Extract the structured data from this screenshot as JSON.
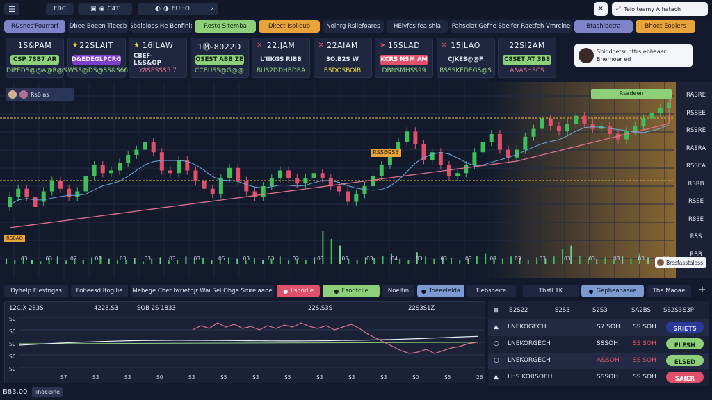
{
  "colors": {
    "bg": "#141a2e",
    "panel": "#1e2640",
    "up": "#3fbf5a",
    "down": "#e0506a",
    "gold": "#c9a43a",
    "pink": "#e07090",
    "accent_orange": "#e8a43a",
    "accent_green": "#8ed07a",
    "accent_purple": "#7d84c8"
  },
  "topbar": {
    "menu_icon": "menu-icon",
    "tool_a": "EBC",
    "tool_b_icons": [
      "grid-icon",
      "circle-icon"
    ],
    "tool_b_label": "C4T",
    "tool_c_icons": [
      "settings-icon",
      "layers-icon"
    ],
    "tool_c_label": "6UHO",
    "add_icon": "chevron-icon",
    "close_icon": "close-icon",
    "search_text": "Teio teamy A hatach"
  },
  "tabs": [
    {
      "label": "R&snes'Fourrarf",
      "style": "purple"
    },
    {
      "label": "Dbee Boeen Tieecb",
      "style": "dark"
    },
    {
      "label": "Gbolelods He Benfinie",
      "style": "dark"
    },
    {
      "label": "Rosto Sitemba",
      "style": "green"
    },
    {
      "label": "Dkect Isolleub",
      "style": "orange"
    },
    {
      "label": "Nolhrg Rsliefoares",
      "style": "dark"
    },
    {
      "label": "HElvfes fea shla",
      "style": "dark"
    },
    {
      "label": "Pahselat Gefhe Sbeifer Raetfeh Vmrcine",
      "style": "dark"
    },
    {
      "label": "Btashibetra",
      "style": "purple"
    },
    {
      "label": "Bhoet Eoplers",
      "style": "orange"
    }
  ],
  "cards": [
    {
      "t1": "1S&PAM",
      "pill": "CSP 7SB7 AR",
      "pillcolor": "green",
      "t3": "DIPEDS@@A@R@S",
      "t3color": "green",
      "icon": ""
    },
    {
      "t1": "22SLAIT",
      "pill": "D&EDEGLPCRG",
      "pillcolor": "purple",
      "t3": "WSS@DS@SS&S66",
      "t3color": "green",
      "icon": "star-icon"
    },
    {
      "t1": "16ILAW",
      "pill": "CBEF- L&S&OP",
      "pillcolor": "none",
      "t3": "Y8SESSS5.7",
      "t3color": "pink",
      "icon": "star-icon"
    },
    {
      "t1": "1Ⓜ-8022D",
      "pill": "OSEST ABB ZE",
      "pillcolor": "green",
      "t3": "CCBUSS@G@@",
      "t3color": "green",
      "icon": ""
    },
    {
      "t1": "22.JAM",
      "pill": "L'IIKGS RIBB",
      "pillcolor": "none",
      "t3": "BUS2DDHBDBA",
      "t3color": "green",
      "icon": "x-icon"
    },
    {
      "t1": "22AIAM",
      "pill": "3O.B2S W",
      "pillcolor": "none",
      "t3": "BSDOSBOIB",
      "t3color": "yellow",
      "icon": "x-icon"
    },
    {
      "t1": "15SLAD",
      "pill": "KCRS NSM AM",
      "pillcolor": "red",
      "t3": "DBNSMHSS99",
      "t3color": "green",
      "icon": "arrow-icon"
    },
    {
      "t1": "15JLAO",
      "pill": "CJKES@@F",
      "pillcolor": "none",
      "t3": "BSSSKEDEGS@S",
      "t3color": "green",
      "icon": "x-icon"
    },
    {
      "t1": "22SI2AM",
      "pill": "C8SET AT 3B8",
      "pillcolor": "green",
      "t3": "A&ASHSCS",
      "t3color": "pink",
      "icon": ""
    }
  ],
  "notification": {
    "title": "Sbiddoetsr bttrs ebhaaer",
    "body": "Bnernoer ed"
  },
  "chart": {
    "header_chip": "Rs6 as",
    "label_right_top": "Rsadeen",
    "box_label": "RSSEGSB",
    "left_tag": "RS8AO",
    "axis_labels": [
      "RASRE",
      "RSSEE",
      "RSSRE",
      "RASRA",
      "RSSEA",
      "RSRB",
      "RSSE",
      "R83E",
      "RSS",
      "RBB"
    ],
    "x_labels": [
      "03",
      "03",
      "02",
      "03",
      "03",
      "03",
      "03",
      "03",
      "05",
      "03",
      "03",
      "03",
      "03",
      "03",
      "03",
      "04",
      "03",
      "03",
      "03",
      "03",
      "03",
      "03",
      "03",
      "03",
      "03",
      "03",
      "03"
    ],
    "badge_br": "Brssfasstalass",
    "candles": [
      {
        "o": 320,
        "c": 300
      },
      {
        "o": 300,
        "c": 285
      },
      {
        "o": 285,
        "c": 300
      },
      {
        "o": 300,
        "c": 320
      },
      {
        "o": 310,
        "c": 290
      },
      {
        "o": 290,
        "c": 270
      },
      {
        "o": 270,
        "c": 285
      },
      {
        "o": 285,
        "c": 300
      },
      {
        "o": 300,
        "c": 290
      },
      {
        "o": 290,
        "c": 260
      },
      {
        "o": 260,
        "c": 240
      },
      {
        "o": 240,
        "c": 255
      },
      {
        "o": 255,
        "c": 250
      },
      {
        "o": 250,
        "c": 235
      },
      {
        "o": 235,
        "c": 220
      },
      {
        "o": 220,
        "c": 210
      },
      {
        "o": 210,
        "c": 195
      },
      {
        "o": 195,
        "c": 215
      },
      {
        "o": 215,
        "c": 250
      },
      {
        "o": 250,
        "c": 255
      },
      {
        "o": 255,
        "c": 230
      },
      {
        "o": 230,
        "c": 250
      },
      {
        "o": 250,
        "c": 270
      },
      {
        "o": 270,
        "c": 285
      },
      {
        "o": 285,
        "c": 295
      },
      {
        "o": 295,
        "c": 265
      },
      {
        "o": 265,
        "c": 245
      },
      {
        "o": 245,
        "c": 270
      },
      {
        "o": 270,
        "c": 290
      },
      {
        "o": 290,
        "c": 300
      },
      {
        "o": 300,
        "c": 280
      },
      {
        "o": 280,
        "c": 265
      },
      {
        "o": 265,
        "c": 250
      },
      {
        "o": 250,
        "c": 265
      },
      {
        "o": 265,
        "c": 275
      },
      {
        "o": 275,
        "c": 265
      },
      {
        "o": 265,
        "c": 255
      },
      {
        "o": 255,
        "c": 265
      },
      {
        "o": 265,
        "c": 280
      },
      {
        "o": 280,
        "c": 290
      },
      {
        "o": 290,
        "c": 310
      },
      {
        "o": 310,
        "c": 295
      },
      {
        "o": 295,
        "c": 280
      },
      {
        "o": 280,
        "c": 260
      },
      {
        "o": 260,
        "c": 240
      },
      {
        "o": 240,
        "c": 215
      },
      {
        "o": 215,
        "c": 195
      },
      {
        "o": 195,
        "c": 175
      },
      {
        "o": 175,
        "c": 200
      },
      {
        "o": 200,
        "c": 230
      },
      {
        "o": 230,
        "c": 215
      },
      {
        "o": 215,
        "c": 240
      },
      {
        "o": 240,
        "c": 260
      },
      {
        "o": 260,
        "c": 255
      },
      {
        "o": 255,
        "c": 240
      },
      {
        "o": 240,
        "c": 215
      },
      {
        "o": 215,
        "c": 195
      },
      {
        "o": 195,
        "c": 180
      },
      {
        "o": 180,
        "c": 210
      },
      {
        "o": 210,
        "c": 225
      },
      {
        "o": 225,
        "c": 210
      },
      {
        "o": 210,
        "c": 185
      },
      {
        "o": 185,
        "c": 170
      },
      {
        "o": 170,
        "c": 150
      },
      {
        "o": 150,
        "c": 165
      },
      {
        "o": 165,
        "c": 175
      },
      {
        "o": 175,
        "c": 160
      },
      {
        "o": 160,
        "c": 145
      },
      {
        "o": 145,
        "c": 160
      },
      {
        "o": 160,
        "c": 170
      },
      {
        "o": 170,
        "c": 165
      },
      {
        "o": 165,
        "c": 180
      },
      {
        "o": 180,
        "c": 190
      },
      {
        "o": 190,
        "c": 175
      },
      {
        "o": 175,
        "c": 165
      },
      {
        "o": 165,
        "c": 150
      },
      {
        "o": 150,
        "c": 140
      },
      {
        "o": 140,
        "c": 130
      },
      {
        "o": 130,
        "c": 120
      }
    ],
    "volume": [
      6,
      4,
      8,
      5,
      3,
      7,
      9,
      4,
      6,
      5,
      8,
      10,
      6,
      4,
      5,
      7,
      3,
      6,
      8,
      4,
      5,
      9,
      6,
      7,
      4,
      5,
      8,
      6,
      4,
      7,
      5,
      6,
      9,
      4,
      6,
      5,
      8,
      40,
      30,
      22,
      6,
      5,
      8,
      7,
      10,
      12,
      6,
      5,
      14,
      9,
      6,
      8,
      7,
      5,
      6,
      10,
      12,
      8,
      6,
      9,
      7,
      5,
      8,
      6,
      9,
      18,
      22,
      10,
      7,
      6,
      8,
      5,
      9,
      7,
      12,
      8,
      6,
      5
    ]
  },
  "bottom_tabs": [
    {
      "label": "Dyhelp Elestnges",
      "style": "plain"
    },
    {
      "label": "Fobeesd Itogilie",
      "style": "plain"
    },
    {
      "label": "Mebege Chet Iwrietnjr Wai Sel Ohge Snirelaane",
      "style": "plain"
    },
    {
      "label": "Ilshodie",
      "style": "red"
    },
    {
      "label": "Esodtclie",
      "style": "green"
    },
    {
      "label": "Noeltin",
      "style": "plain"
    },
    {
      "label": "Toeeelelda",
      "style": "blue"
    },
    {
      "label": "Tlebsheite",
      "style": "plain"
    },
    {
      "label": "Tbstl 1K",
      "style": "plain"
    },
    {
      "label": "Gepheanasiie",
      "style": "blue"
    },
    {
      "label": "The Maoae",
      "style": "plain"
    }
  ],
  "lower_chart": {
    "headers": [
      "12C.X 2S3S",
      "4228.S3",
      "SOB 2S 1833",
      "22S.S3S",
      "22S3S1Z"
    ],
    "y_labels": [
      "S0",
      "S0",
      "S0",
      "S0",
      "S0"
    ],
    "x_labels": [
      "S7",
      "S3",
      "S3",
      "S0",
      "S3",
      "S5",
      "S3",
      "S5",
      "S3",
      "S3",
      "S3",
      "S0",
      "S5",
      "26"
    ]
  },
  "table": {
    "headers": [
      "B2S22",
      "S2S3",
      "S2S3",
      "SA2BS",
      "SS2S3",
      "S3P"
    ],
    "rows": [
      {
        "icon": "triangle-icon",
        "name": "LNEKOGECH",
        "v1": "S7 SOH",
        "v2": "SS SOH",
        "v2color": "white",
        "action": "SRIETS",
        "actionstyle": "blue"
      },
      {
        "icon": "circle-outline-icon",
        "name": "LNEKORGECH",
        "v1": "SSSOH",
        "v2": "SS SOH",
        "v2color": "red",
        "action": "FLESH",
        "actionstyle": "green"
      },
      {
        "icon": "circle-outline-icon",
        "name": "LNEKORGECH",
        "v1": "A&SOH",
        "v2": "SS SOH",
        "v2color": "red",
        "action": "ELSED",
        "actionstyle": "green"
      },
      {
        "icon": "triangle-icon",
        "name": "LHS KORSOEH",
        "v1": "SSSOH",
        "v2": "SS SOH",
        "v2color": "white",
        "action": "SAIER",
        "actionstyle": "red"
      }
    ]
  },
  "footer": {
    "price": "B83.00",
    "label": "Iinoeeine"
  }
}
